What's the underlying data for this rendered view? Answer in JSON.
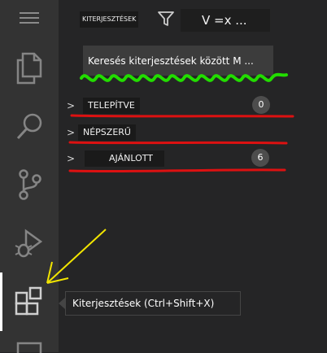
{
  "activity_bar": {
    "items": [
      {
        "name": "menu-icon"
      },
      {
        "name": "explorer-icon"
      },
      {
        "name": "search-icon"
      },
      {
        "name": "source-control-icon"
      },
      {
        "name": "run-debug-icon"
      },
      {
        "name": "extensions-icon",
        "active": true
      },
      {
        "name": "remote-icon"
      }
    ]
  },
  "sidebar": {
    "title": "KITERJESZTÉSEK",
    "views_label": "V =x ...",
    "search": {
      "value": "",
      "placeholder": "Keresés kiterjesztések között M ..."
    },
    "sections": [
      {
        "chevron": ">",
        "label": "TELEPÍTVE",
        "count": "0"
      },
      {
        "chevron": ">",
        "label": "NÉPSZERŰ",
        "count": ""
      },
      {
        "chevron": ">",
        "label": "AJÁNLOTT",
        "count": "6"
      }
    ]
  },
  "tooltip": {
    "text": "Kiterjesztések (Ctrl+Shift+X)"
  },
  "colors": {
    "activity_bar": "#333333",
    "sidebar": "#252526",
    "annotation_green": "#22dd00",
    "annotation_red": "#dd1111",
    "annotation_yellow": "#f2e500"
  }
}
